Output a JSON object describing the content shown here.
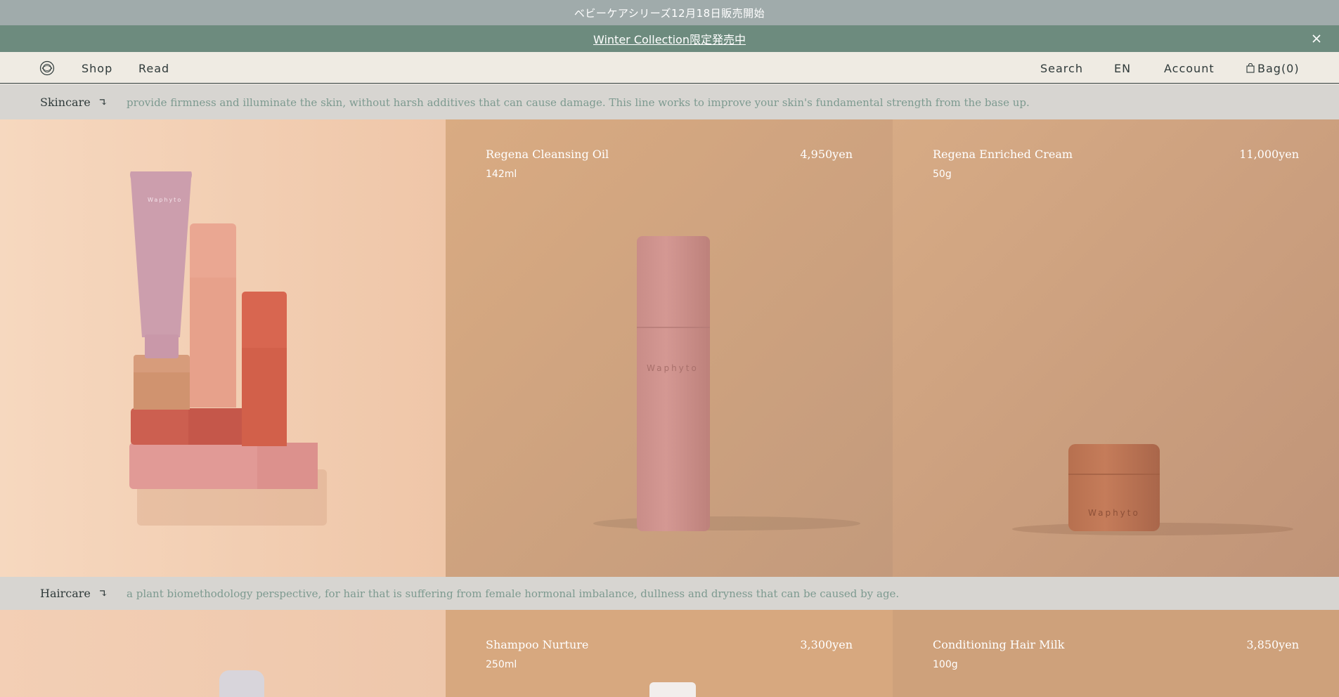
{
  "announcement": {
    "text": "ベビーケアシリーズ12月18日販売開始"
  },
  "promo": {
    "link_text": "Winter Collection限定発売中"
  },
  "nav": {
    "left": [
      "Shop",
      "Read"
    ],
    "search": "Search",
    "language": "EN",
    "account": "Account",
    "bag": "Bag(0)"
  },
  "brand": {
    "product_print": "Waphyto"
  },
  "sections": [
    {
      "category": "Skincare",
      "arrow": "↴",
      "description": "provide firmness and illuminate the skin, without harsh additives that can cause damage. This line works to improve your skin's fundamental strength from the base up.",
      "products": [
        {
          "name": "Regena Cleansing Oil",
          "price": "4,950yen",
          "size": "142ml"
        },
        {
          "name": "Regena Enriched Cream",
          "price": "11,000yen",
          "size": "50g"
        }
      ]
    },
    {
      "category": "Haircare",
      "arrow": "↴",
      "description": "a plant biomethodology perspective, for hair that is suffering from female hormonal imbalance, dullness and dryness that can be caused by age.",
      "products": [
        {
          "name": "Shampoo Nurture",
          "price": "3,300yen",
          "size": "250ml"
        },
        {
          "name": "Conditioning Hair Milk",
          "price": "3,850yen",
          "size": "100g"
        }
      ]
    }
  ],
  "colors": {
    "announcement_bg": "#a0abab",
    "promo_bg": "#6d8b7e",
    "nav_bg": "#efebe3",
    "category_bar_bg": "#d7d5d1",
    "description_text": "#7d9a90",
    "panel_peach": "#f2cdb2",
    "panel_tan": "#d2a67f",
    "panel_brown": "#cfa27c"
  },
  "icons": [
    "logo-icon",
    "close-icon",
    "bag-icon"
  ]
}
